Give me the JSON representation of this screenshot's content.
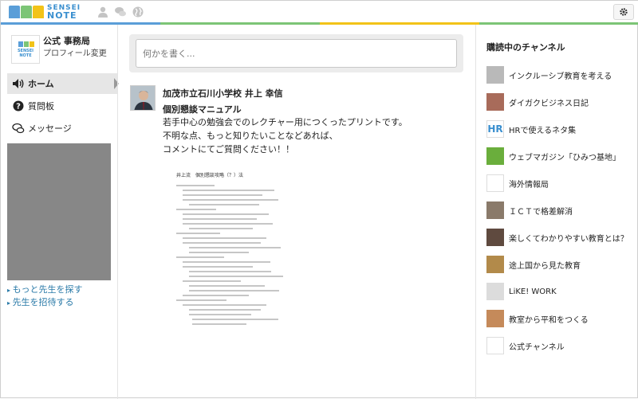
{
  "brand": {
    "line1": "SENSEI",
    "line2": "NOTE"
  },
  "header": {
    "icons": [
      "user-icon",
      "chat-icon",
      "globe-icon"
    ],
    "settings_icon": "gear-icon"
  },
  "profile": {
    "name": "公式 事務局",
    "edit_label": "プロフィール変更",
    "avatar_line1": "SENSEI",
    "avatar_line2": "NOTE"
  },
  "nav": {
    "items": [
      {
        "label": "ホーム",
        "icon": "speaker-icon",
        "active": true
      },
      {
        "label": "質問板",
        "icon": "question-icon",
        "active": false
      },
      {
        "label": "メッセージ",
        "icon": "chat-icon",
        "active": false
      }
    ]
  },
  "side_links": [
    "もっと先生を探す",
    "先生を招待する"
  ],
  "composer": {
    "placeholder": "何かを書く..."
  },
  "post": {
    "author": "加茂市立石川小学校 井上 幸信",
    "title": "個別懇談マニュアル",
    "body": [
      "若手中心の勉強会でのレクチャー用につくったプリントです。",
      "不明な点、もっと知りたいことなどあれば、",
      "コメントにてご質問ください！！"
    ],
    "attachment_title": "井上流　個別懇談攻略（？）法"
  },
  "channels": {
    "heading": "購読中のチャンネル",
    "items": [
      {
        "name": "インクルーシブ教育を考える",
        "thumb": "#b9b9b9",
        "thumb_text": ""
      },
      {
        "name": "ダイガクビジネス日記",
        "thumb": "#a86b5a",
        "thumb_text": ""
      },
      {
        "name": "HRで使えるネタ集",
        "thumb": "#ffffff",
        "thumb_text": "HR"
      },
      {
        "name": "ウェブマガジン「ひみつ基地」",
        "thumb": "#6aae3c",
        "thumb_text": ""
      },
      {
        "name": "海外情報局",
        "thumb": "#ffffff",
        "thumb_text": ""
      },
      {
        "name": "ＩＣＴで格差解消",
        "thumb": "#8a7a6a",
        "thumb_text": ""
      },
      {
        "name": "楽しくてわかりやすい教育とは？",
        "thumb": "#5f4a3f",
        "thumb_text": ""
      },
      {
        "name": "途上国から見た教育",
        "thumb": "#b28a4a",
        "thumb_text": ""
      },
      {
        "name": "LiKE! WORK",
        "thumb": "#dcdcdc",
        "thumb_text": ""
      },
      {
        "name": "教室から平和をつくる",
        "thumb": "#c58a5a",
        "thumb_text": ""
      },
      {
        "name": "公式チャンネル",
        "thumb": "#ffffff",
        "thumb_text": ""
      }
    ]
  }
}
